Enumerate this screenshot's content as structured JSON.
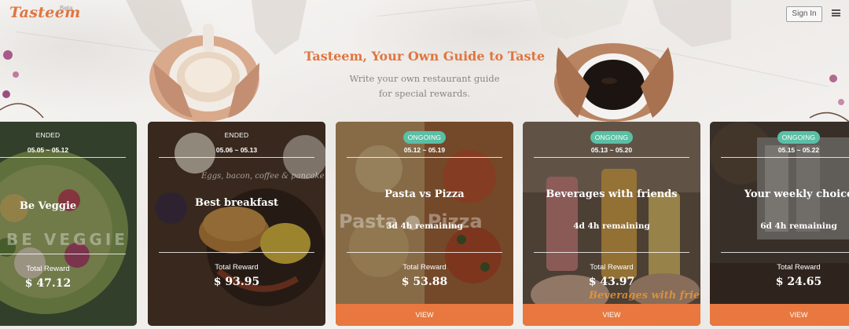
{
  "header": {
    "logo": "Tasteem",
    "logo_badge": "Beta",
    "signin_label": "Sign In"
  },
  "hero": {
    "title": "Tasteem, Your Own Guide to Taste",
    "subtitle_line1": "Write your own restaurant guide",
    "subtitle_line2": "for special rewards."
  },
  "cards": [
    {
      "status": "ENDED",
      "dates": "05.05 ~ 05.12",
      "title": "Be Veggie",
      "remaining": "",
      "reward_label": "Total Reward",
      "reward": "$ 47.12",
      "photo_text": "BE VEGGIE",
      "view": ""
    },
    {
      "status": "ENDED",
      "dates": "05.06 ~ 05.13",
      "title": "Best breakfast",
      "remaining": "",
      "reward_label": "Total Reward",
      "reward": "$ 93.95",
      "photo_text": "Eggs, bacon, coffee & pancake",
      "view": ""
    },
    {
      "status": "ONGOING",
      "dates": "05.12 ~ 05.19",
      "title": "Pasta vs Pizza",
      "remaining": "3d 4h remaining",
      "reward_label": "Total Reward",
      "reward": "$ 53.88",
      "photo_text": "Pasta ● Pizza",
      "view": "VIEW"
    },
    {
      "status": "ONGOING",
      "dates": "05.13 ~ 05.20",
      "title": "Beverages with friends",
      "remaining": "4d 4h remaining",
      "reward_label": "Total Reward",
      "reward": "$ 43.97",
      "photo_text": "Beverages with friends",
      "view": "VIEW"
    },
    {
      "status": "ONGOING",
      "dates": "05.15 ~ 05.22",
      "title": "Your weekly choice",
      "remaining": "6d 4h remaining",
      "reward_label": "Total Reward",
      "reward": "$ 24.65",
      "photo_text": "",
      "view": "VIEW"
    }
  ],
  "colors": {
    "accent": "#e0753f",
    "view_button": "#e8783f",
    "ongoing_pill": "#5bbfa4"
  }
}
